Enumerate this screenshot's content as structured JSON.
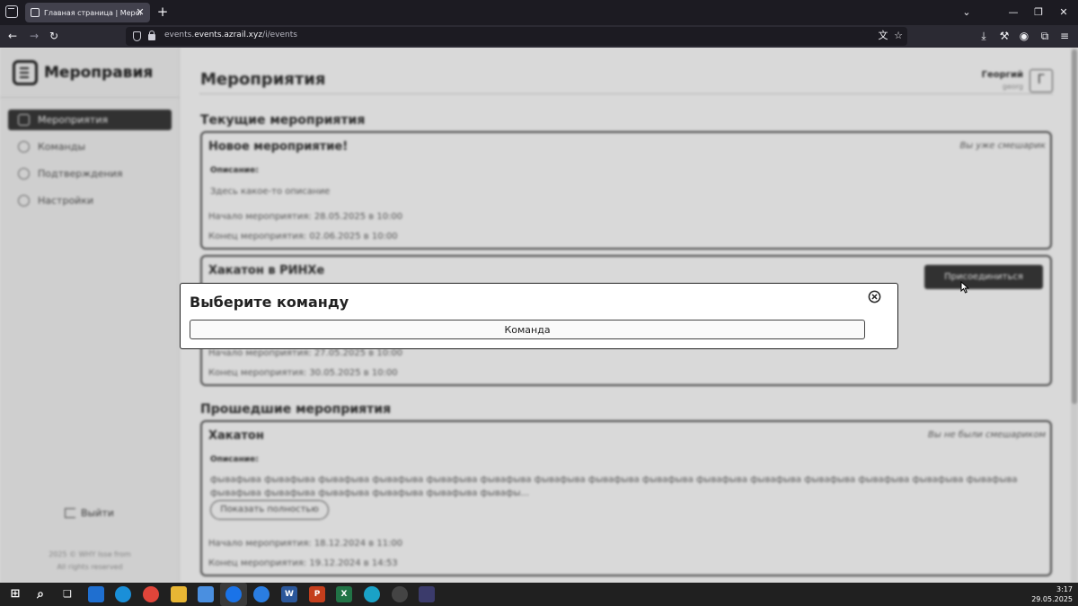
{
  "browser": {
    "tab_title": "Главная страница | Мероправия",
    "url_host": "events.azrail.xyz",
    "url_path": "/i/events",
    "url_prefix": "events."
  },
  "sidebar": {
    "logo": "Мероправия",
    "items": [
      {
        "label": "Мероприятия",
        "icon": "calendar-icon",
        "active": true
      },
      {
        "label": "Команды",
        "icon": "people-icon",
        "active": false
      },
      {
        "label": "Подтверждения",
        "icon": "check-circle-icon",
        "active": false
      },
      {
        "label": "Настройки",
        "icon": "gear-icon",
        "active": false
      }
    ],
    "logout": "Выйти",
    "copyright_line1": "2025 © WHY Isse from",
    "copyright_line2": "All rights reserved"
  },
  "header": {
    "title": "Мероприятия",
    "user_name": "Георгий",
    "user_login": "georg",
    "avatar_letter": "Г"
  },
  "sections": {
    "current": "Текущие мероприятия",
    "past": "Прошедшие мероприятия"
  },
  "events": [
    {
      "title": "Новое мероприятие!",
      "status": "Вы уже смешарик",
      "desc_label": "Описание:",
      "description": "Здесь какое-то описание",
      "start": "Начало мероприятия: 28.05.2025 в 10:00",
      "end": "Конец мероприятия: 02.06.2025 в 10:00"
    },
    {
      "title": "Хакатон в РИНХе",
      "join_label": "Присоединиться",
      "start": "Начало мероприятия: 27.05.2025 в 10:00",
      "end": "Конец мероприятия: 30.05.2025 в 10:00"
    },
    {
      "title": "Хакатон",
      "status": "Вы не были смешариком",
      "desc_label": "Описание:",
      "description": "фывафыва фывафыва фывафыва фывафыва фывафыва фывафыва фывафыва фывафыва фывафыва фывафыва фывафыва фывафыва фывафыва фывафыва фывафыва фывафыва фывафыва фывафыва фывафыва фывафыва фывафы...",
      "show_more": "Показать полностью",
      "start": "Начало мероприятия: 18.12.2024 в 11:00",
      "end": "Конец мероприятия: 19.12.2024 в 14:53"
    }
  ],
  "modal": {
    "title": "Выберите команду",
    "team_button": "Команда"
  },
  "taskbar": {
    "time": "3:17",
    "date": "29.05.2025"
  }
}
